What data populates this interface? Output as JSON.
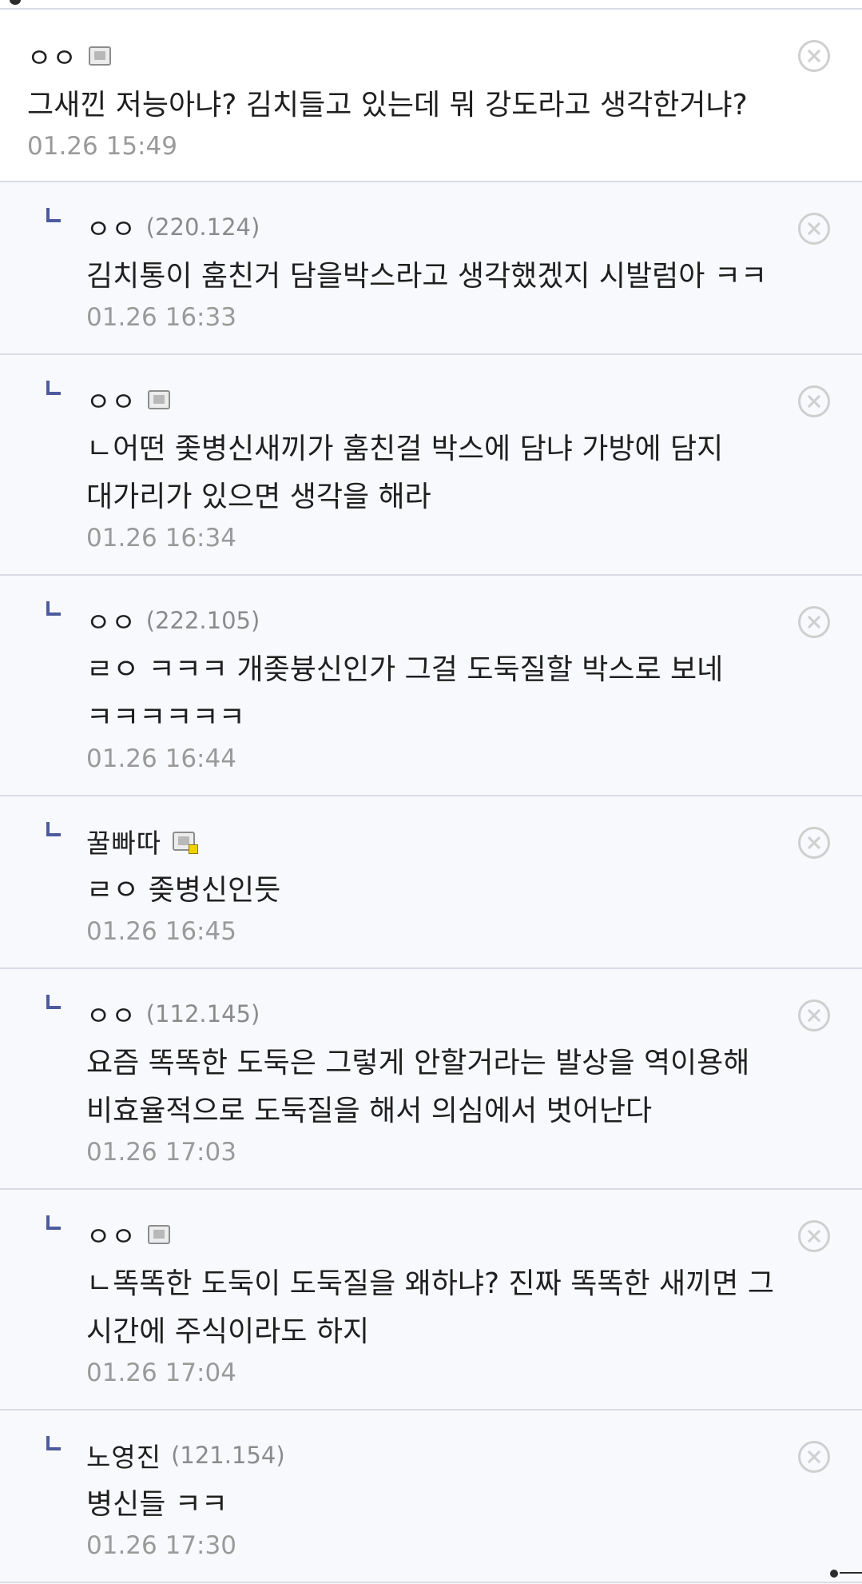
{
  "comments": [
    {
      "nick": "ㅇㅇ",
      "ip": "",
      "text": "그새낀 저능아냐? 김치들고 있는데 뭐 강도라고 생각한거냐?",
      "date": "01.26 15:49"
    },
    {
      "nick": "ㅇㅇ",
      "ip": "(220.124)",
      "text": "김치통이 훔친거 담을박스라고 생각했겠지 시발럼아 ㅋㅋ",
      "date": "01.26 16:33"
    },
    {
      "nick": "ㅇㅇ",
      "ip": "",
      "text": "ㄴ어떤 좇병신새끼가 훔친걸 박스에 담냐 가방에 담지 대가리가 있으면 생각을 해라",
      "date": "01.26 16:34"
    },
    {
      "nick": "ㅇㅇ",
      "ip": "(222.105)",
      "text": "ㄹㅇ ㅋㅋㅋ 개좆븅신인가 그걸 도둑질할 박스로 보네 ㅋㅋㅋㅋㅋㅋ",
      "date": "01.26 16:44"
    },
    {
      "nick": "꿀빠따",
      "ip": "",
      "text": "ㄹㅇ 좆병신인듯",
      "date": "01.26 16:45"
    },
    {
      "nick": "ㅇㅇ",
      "ip": "(112.145)",
      "text": "요즘 똑똑한 도둑은 그렇게 안할거라는 발상을 역이용해 비효율적으로 도둑질을 해서 의심에서 벗어난다",
      "date": "01.26 17:03"
    },
    {
      "nick": "ㅇㅇ",
      "ip": "",
      "text": "ㄴ똑똑한 도둑이 도둑질을 왜하냐? 진짜 똑똑한 새끼면 그 시간에 주식이라도 하지",
      "date": "01.26 17:04"
    },
    {
      "nick": "노영진",
      "ip": "(121.154)",
      "text": "병신들 ㅋㅋ",
      "date": "01.26 17:30"
    }
  ]
}
